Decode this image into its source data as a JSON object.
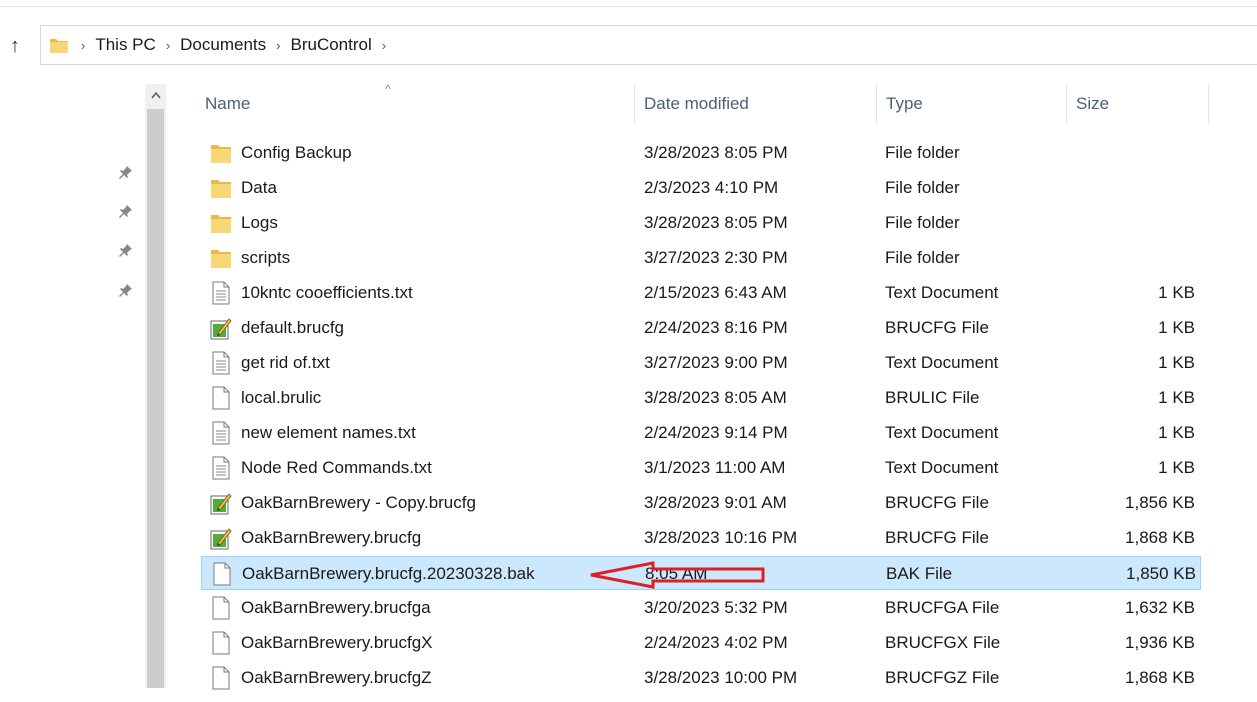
{
  "address": {
    "crumbs": [
      "This PC",
      "Documents",
      "BruControl"
    ]
  },
  "columns": {
    "name": "Name",
    "date": "Date modified",
    "type": "Type",
    "size": "Size"
  },
  "files": [
    {
      "icon": "folder-icon",
      "name": "Config Backup",
      "date": "3/28/2023 8:05 PM",
      "type": "File folder",
      "size": ""
    },
    {
      "icon": "folder-icon",
      "name": "Data",
      "date": "2/3/2023 4:10 PM",
      "type": "File folder",
      "size": ""
    },
    {
      "icon": "folder-icon",
      "name": "Logs",
      "date": "3/28/2023 8:05 PM",
      "type": "File folder",
      "size": ""
    },
    {
      "icon": "folder-icon",
      "name": "scripts",
      "date": "3/27/2023 2:30 PM",
      "type": "File folder",
      "size": ""
    },
    {
      "icon": "text-file-icon",
      "name": "10kntc cooefficients.txt",
      "date": "2/15/2023 6:43 AM",
      "type": "Text Document",
      "size": "1 KB"
    },
    {
      "icon": "edit-file-icon",
      "name": "default.brucfg",
      "date": "2/24/2023 8:16 PM",
      "type": "BRUCFG File",
      "size": "1 KB"
    },
    {
      "icon": "text-file-icon",
      "name": "get rid of.txt",
      "date": "3/27/2023 9:00 PM",
      "type": "Text Document",
      "size": "1 KB"
    },
    {
      "icon": "blank-file-icon",
      "name": "local.brulic",
      "date": "3/28/2023 8:05 AM",
      "type": "BRULIC File",
      "size": "1 KB"
    },
    {
      "icon": "text-file-icon",
      "name": "new element names.txt",
      "date": "2/24/2023 9:14 PM",
      "type": "Text Document",
      "size": "1 KB"
    },
    {
      "icon": "text-file-icon",
      "name": "Node Red Commands.txt",
      "date": "3/1/2023 11:00 AM",
      "type": "Text Document",
      "size": "1 KB"
    },
    {
      "icon": "edit-file-icon",
      "name": "OakBarnBrewery - Copy.brucfg",
      "date": "3/28/2023 9:01 AM",
      "type": "BRUCFG File",
      "size": "1,856 KB"
    },
    {
      "icon": "edit-file-icon",
      "name": "OakBarnBrewery.brucfg",
      "date": "3/28/2023 10:16 PM",
      "type": "BRUCFG File",
      "size": "1,868 KB"
    },
    {
      "icon": "blank-file-icon",
      "name": "OakBarnBrewery.brucfg.20230328.bak",
      "date": "8:05 AM",
      "type": "BAK File",
      "size": "1,850 KB",
      "selected": true
    },
    {
      "icon": "blank-file-icon",
      "name": "OakBarnBrewery.brucfga",
      "date": "3/20/2023 5:32 PM",
      "type": "BRUCFGA File",
      "size": "1,632 KB"
    },
    {
      "icon": "blank-file-icon",
      "name": "OakBarnBrewery.brucfgX",
      "date": "2/24/2023 4:02 PM",
      "type": "BRUCFGX File",
      "size": "1,936 KB"
    },
    {
      "icon": "blank-file-icon",
      "name": "OakBarnBrewery.brucfgZ",
      "date": "3/28/2023 10:00 PM",
      "type": "BRUCFGZ File",
      "size": "1,868 KB"
    }
  ],
  "colors": {
    "selection_bg": "#cce8ff",
    "selection_border": "#99d1ff",
    "folder": "#f8d775",
    "annotation_arrow": "#e02020",
    "header_text": "#4c607a"
  }
}
